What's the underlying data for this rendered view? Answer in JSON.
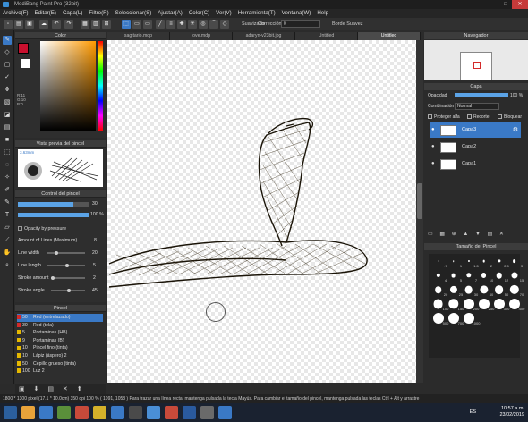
{
  "app": {
    "title": "MediBang Paint Pro (32bit)"
  },
  "menu": [
    "Archivo(F)",
    "Editar(E)",
    "Capa(L)",
    "Filtro(R)",
    "Seleccionar(S)",
    "Ajustar(A)",
    "Color(C)",
    "Ver(V)",
    "Herramienta(T)",
    "Ventana(W)",
    "Help"
  ],
  "toolbar": {
    "suavizado": "Suavizado",
    "correccion": "Corrección",
    "correccion_value": "0",
    "borde": "Borde Suavez"
  },
  "tabs": [
    "sagitario.mdp",
    "love.mdp",
    "adaryn-v23bit.jpg",
    "Untitled",
    "Untitled"
  ],
  "color_panel": {
    "title": "Color",
    "r": "R:11",
    "g": "G:10",
    "b": "B:0"
  },
  "preview_panel": {
    "title": "Vista previa del pincel",
    "size": "3.63mm"
  },
  "control_panel": {
    "title": "Control del pincel",
    "size_value": "30",
    "opacity_value": "100 %",
    "opacity_by_pressure": "Opacity by pressure",
    "rows": [
      {
        "label": "Amount of Lines (Maximum)",
        "value": "8"
      },
      {
        "label": "Line width",
        "value": "20"
      },
      {
        "label": "Line length",
        "value": "5"
      },
      {
        "label": "Stroke amount",
        "value": "2"
      },
      {
        "label": "Stroke angle",
        "value": "45"
      }
    ]
  },
  "brush_panel": {
    "title": "Pincel",
    "items": [
      {
        "num": "50",
        "name": "Red (entrelazado)",
        "color": "#d42a2a"
      },
      {
        "num": "30",
        "name": "Red (tela)",
        "color": "#d42a2a"
      },
      {
        "num": "5",
        "name": "Portaminas (HB)",
        "color": "#e5b800"
      },
      {
        "num": "9",
        "name": "Portaminas (B)",
        "color": "#e5b800"
      },
      {
        "num": "10",
        "name": "Pincel fino (tinta)",
        "color": "#e5b800"
      },
      {
        "num": "10",
        "name": "Lápiz (áspero) 2",
        "color": "#e5b800"
      },
      {
        "num": "50",
        "name": "Cepillo grueso (tinta)",
        "color": "#e5b800"
      },
      {
        "num": "100",
        "name": "Luz 2",
        "color": "#e5b800"
      }
    ]
  },
  "navigator": {
    "title": "Navegador"
  },
  "layers": {
    "title": "Capa",
    "opacity_label": "Opacidad",
    "opacity_value": "100 %",
    "blend_label": "Combinación",
    "blend_value": "Normal",
    "protect": "Proteger alfa",
    "clip": "Recorte",
    "lock": "Bloquear",
    "items": [
      "Capa3",
      "Capa2",
      "Capa1"
    ]
  },
  "brush_size": {
    "title": "Tamaño del Pincel",
    "sizes": [
      ".7",
      "1",
      "1.5",
      "2",
      "2.5",
      "3",
      "4",
      "5",
      "7",
      "10",
      "12",
      "15",
      "20",
      "25",
      "30",
      "40",
      "50",
      "70",
      "100",
      "150",
      "200",
      "250",
      "300",
      "400",
      "500",
      "700",
      "1000"
    ]
  },
  "status": {
    "text": "1800 * 1300 pixel  (17.1 * 10.0cm)  350 dpi  100 %  ( 1091, 1058 )  Para trazar una línea recta, mantenga pulsada la tecla Mayús. Para cambiar el tamaño del pincel, mantenga pulsada las teclas Ctrl + Alt y arrastre"
  },
  "taskbar": {
    "lang": "ES",
    "time": "10:57 a.m.",
    "date": "23/02/2019"
  }
}
